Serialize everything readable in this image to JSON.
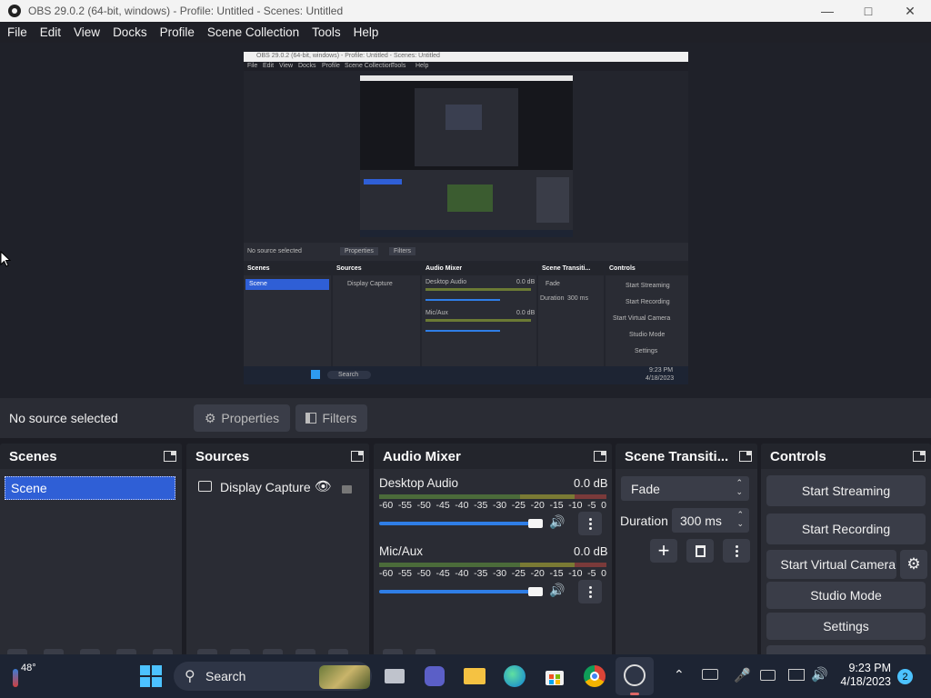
{
  "window": {
    "title": "OBS 29.0.2 (64-bit, windows) - Profile: Untitled - Scenes: Untitled"
  },
  "menu": [
    "File",
    "Edit",
    "View",
    "Docks",
    "Profile",
    "Scene Collection",
    "Tools",
    "Help"
  ],
  "source_bar": {
    "status": "No source selected",
    "properties_label": "Properties",
    "filters_label": "Filters"
  },
  "scenes": {
    "title": "Scenes",
    "items": [
      "Scene"
    ]
  },
  "sources": {
    "title": "Sources",
    "items": [
      "Display Capture"
    ]
  },
  "audio_mixer": {
    "title": "Audio Mixer",
    "scale": [
      "-60",
      "-55",
      "-50",
      "-45",
      "-40",
      "-35",
      "-30",
      "-25",
      "-20",
      "-15",
      "-10",
      "-5",
      "0"
    ],
    "channels": [
      {
        "name": "Desktop Audio",
        "level": "0.0 dB",
        "volume": 1.0
      },
      {
        "name": "Mic/Aux",
        "level": "0.0 dB",
        "volume": 1.0
      }
    ]
  },
  "transitions": {
    "title": "Scene Transiti...",
    "selected": "Fade",
    "duration_label": "Duration",
    "duration_value": "300 ms"
  },
  "controls": {
    "title": "Controls",
    "start_streaming": "Start Streaming",
    "start_recording": "Start Recording",
    "start_virtual_camera": "Start Virtual Camera",
    "studio_mode": "Studio Mode",
    "settings": "Settings"
  },
  "preview_mini": {
    "title": "OBS 29.0.2 (64-bit, windows) - Profile: Untitled - Scenes: Untitled",
    "menu": [
      "File",
      "Edit",
      "View",
      "Docks",
      "Profile",
      "Scene Collection",
      "Tools",
      "Help"
    ],
    "status": "No source selected",
    "properties": "Properties",
    "filters": "Filters",
    "scenes": "Scenes",
    "scene_item": "Scene",
    "sources": "Sources",
    "source_item": "Display Capture",
    "audio_mixer": "Audio Mixer",
    "desktop_audio": "Desktop Audio",
    "mic_aux": "Mic/Aux",
    "db": "0.0 dB",
    "transitions": "Scene Transiti...",
    "fade": "Fade",
    "duration": "Duration",
    "duration_value": "300 ms",
    "controls": "Controls",
    "start_streaming": "Start Streaming",
    "start_recording": "Start Recording",
    "start_virtual": "Start Virtual Camera",
    "studio_mode": "Studio Mode",
    "settings": "Settings",
    "search": "Search",
    "time": "9:23 PM",
    "date": "4/18/2023"
  },
  "taskbar": {
    "weather": "48°",
    "search_placeholder": "Search",
    "time": "9:23 PM",
    "date": "4/18/2023",
    "notifications": "2"
  },
  "colors": {
    "accent": "#2f5fd6",
    "dock_bg": "#2a2c34",
    "header_bg": "#23252c",
    "button_bg": "#3a3d48",
    "taskbar_bg": "#1d2433"
  }
}
